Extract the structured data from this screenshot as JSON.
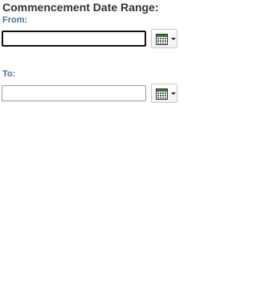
{
  "section": {
    "title": "Commencement Date Range:"
  },
  "from": {
    "label": "From:",
    "value": "",
    "picker_icon": "calendar-icon"
  },
  "to": {
    "label": "To:",
    "value": "",
    "picker_icon": "calendar-icon"
  },
  "colors": {
    "label_blue": "#4a6f99",
    "title_text": "#333333",
    "calendar_green": "#2e7d32"
  }
}
